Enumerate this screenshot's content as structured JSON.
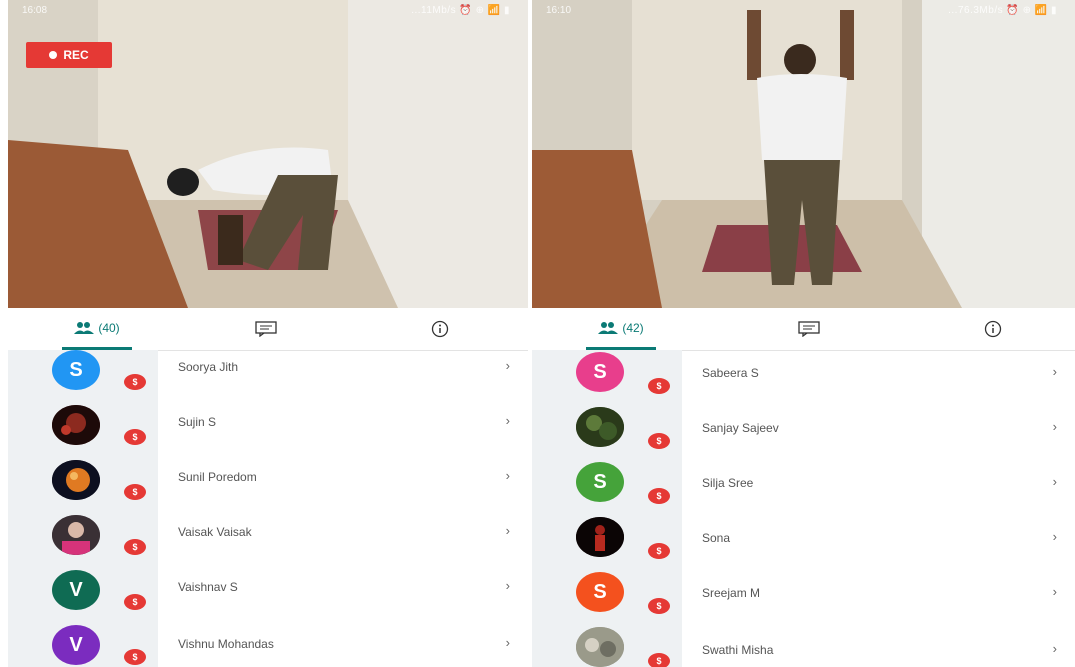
{
  "left": {
    "status": {
      "time": "16:08",
      "network": "...11Mb/s ⏰ ⊕ 📶 ▮"
    },
    "rec_label": "REC",
    "tabs": {
      "people_count": "(40)"
    },
    "participants": [
      {
        "initial": "S",
        "name": "Soorya Jith",
        "avatar_color": "#2196f3",
        "photo": false
      },
      {
        "initial": "",
        "name": "Sujin S",
        "avatar_color": "#5a1a18",
        "photo": true
      },
      {
        "initial": "",
        "name": "Sunil Poredom",
        "avatar_color": "#12131f",
        "photo": true
      },
      {
        "initial": "",
        "name": "Vaisak Vaisak",
        "avatar_color": "#6b5b62",
        "photo": true
      },
      {
        "initial": "V",
        "name": "Vaishnav S",
        "avatar_color": "#0f6b53",
        "photo": false
      },
      {
        "initial": "V",
        "name": "Vishnu Mohandas",
        "avatar_color": "#7b2cbf",
        "photo": false
      }
    ]
  },
  "right": {
    "status": {
      "time": "16:10",
      "network": "...76.3Mb/s ⏰ ⊕ 📶 ▮"
    },
    "tabs": {
      "people_count": "(42)"
    },
    "participants": [
      {
        "initial": "S",
        "name": "Sabeera S",
        "avatar_color": "#e83e8c",
        "photo": false
      },
      {
        "initial": "",
        "name": "Sanjay Sajeev",
        "avatar_color": "#2f4a1e",
        "photo": true
      },
      {
        "initial": "S",
        "name": "Silja Sree",
        "avatar_color": "#45a33a",
        "photo": false
      },
      {
        "initial": "",
        "name": "Sona",
        "avatar_color": "#140707",
        "photo": true
      },
      {
        "initial": "S",
        "name": "Sreejam M",
        "avatar_color": "#f4511e",
        "photo": false
      },
      {
        "initial": "",
        "name": "Swathi Misha",
        "avatar_color": "#8a8a7a",
        "photo": true
      }
    ]
  },
  "icons": {
    "people": "people-icon",
    "chat": "chat-icon",
    "info": "info-icon",
    "chevron": "›",
    "mic_badge": "mic-off-icon"
  }
}
